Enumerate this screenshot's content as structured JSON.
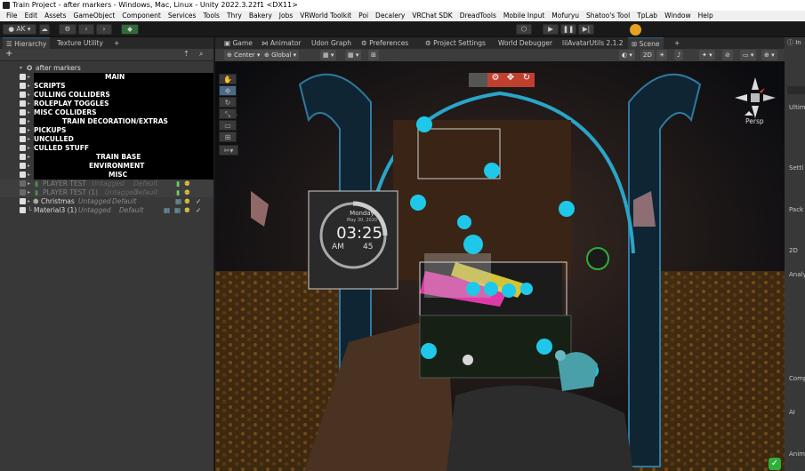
{
  "window": {
    "title": "Train Project - after markers - Windows, Mac, Linux - Unity 2022.3.22f1 <DX11>"
  },
  "menu": [
    "File",
    "Edit",
    "Assets",
    "GameObject",
    "Component",
    "Services",
    "Tools",
    "Thry",
    "Bakery",
    "Jobs",
    "VRWorld Toolkit",
    "Poi",
    "Decalery",
    "VRChat SDK",
    "DreadTools",
    "Mobile Input",
    "Mofuryu",
    "Shatoo's Tool",
    "TpLab",
    "Window",
    "Help"
  ],
  "toolbar": {
    "account": "AK"
  },
  "left_tabs": {
    "hierarchy": "Hierarchy",
    "texture_utility": "Texture Utility"
  },
  "scene_tabs": [
    "Game",
    "Animator",
    "Udon Graph",
    "Preferences",
    "Project Settings",
    "World Debugger",
    "lilAvatarUtils 2.1.2",
    "Scene"
  ],
  "hierarchy": {
    "root": "after markers",
    "headers": [
      "MAIN",
      "TRAIN DECORATION/EXTRAS",
      "TRAIN BASE",
      "ENVIRONMENT",
      "MISC"
    ],
    "items": [
      "SCRIPTS",
      "CULLING COLLIDERS",
      "ROLEPLAY TOGGLES",
      "MISC COLLIDERS",
      "PICKUPS",
      "UNCULLED",
      "CULLED STUFF"
    ],
    "player1": "PLAYER TEST",
    "player1_tag": "Untagged",
    "player1_layer": "Default",
    "player2": "PLAYER TEST (1)",
    "player2_tag": "Untagged",
    "player2_layer": "Default",
    "christmas": "Christmas",
    "christmas_tag": "Untagged",
    "christmas_layer": "Default",
    "material": "Material3 (1)",
    "material_tag": "Untagged",
    "material_layer": "Default"
  },
  "scene_toolbar": {
    "pivot": "Center",
    "space": "Global",
    "mode_2d": "2D"
  },
  "gizmo": {
    "projection": "Persp"
  },
  "clock": {
    "day": "Monday",
    "date": "May 30, 2020",
    "time": "03:25",
    "ampm": "AM",
    "seconds": "45"
  },
  "inspector": {
    "labels": [
      "Ultim",
      "Settl",
      "Pack",
      "2D",
      "Analy",
      "Comp",
      "AI",
      "Anim"
    ]
  },
  "colors": {
    "accent_cyan": "#1fc8e8",
    "tab_accent": "#2c5d87",
    "ok_green": "#2fae3a"
  }
}
